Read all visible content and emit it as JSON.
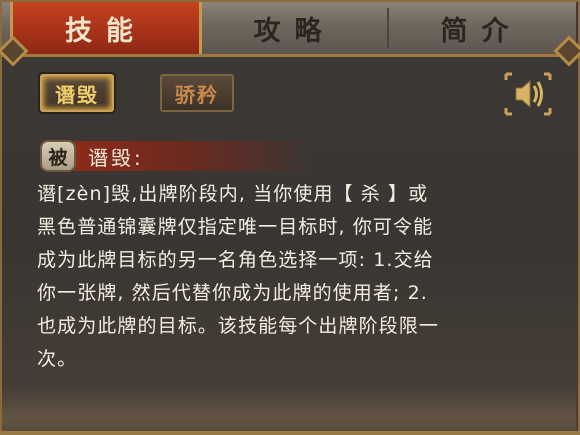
{
  "tabs": [
    {
      "label": "技能",
      "active": true
    },
    {
      "label": "攻略",
      "active": false
    },
    {
      "label": "简介",
      "active": false
    }
  ],
  "skills": [
    {
      "label": "谮毁",
      "selected": true
    },
    {
      "label": "骄矜",
      "selected": false
    }
  ],
  "sound_button": {
    "icon": "speaker-icon"
  },
  "detail": {
    "type_badge": "被",
    "name": "谮毁:",
    "description": "谮[zèn]毁,出牌阶段内, 当你使用【 杀 】或\n黑色普通锦囊牌仅指定唯一目标时, 你可令能\n成为此牌目标的另一名角色选择一项: 1.交给\n你一张牌, 然后代替你成为此牌的使用者; 2.\n也成为此牌的目标。该技能每个出牌阶段限一\n次。"
  },
  "colors": {
    "active_tab": "#b53a1c",
    "accent_gold": "#c9a35d",
    "panel_bg": "#3a3633"
  }
}
